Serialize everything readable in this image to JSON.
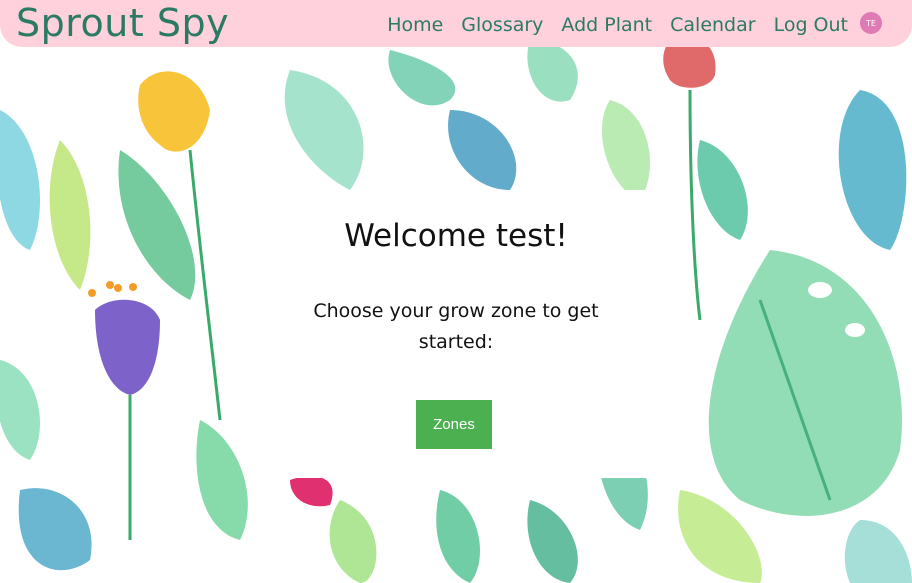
{
  "navbar": {
    "brand": "Sprout Spy",
    "links": [
      "Home",
      "Glossary",
      "Add Plant",
      "Calendar",
      "Log Out"
    ],
    "avatar_initials": "TE"
  },
  "welcome": {
    "title": "Welcome test!",
    "prompt": "Choose your grow zone to get started:",
    "button_label": "Zones"
  },
  "colors": {
    "navbar_bg": "#ffd1dc",
    "brand_text": "#2b7a64",
    "button_bg": "#4caf50",
    "avatar_bg": "#e07ab4"
  }
}
